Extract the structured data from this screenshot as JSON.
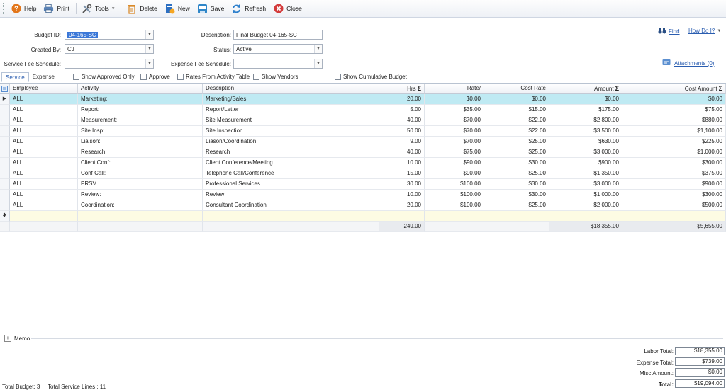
{
  "toolbar": {
    "help": "Help",
    "print": "Print",
    "tools": "Tools",
    "delete": "Delete",
    "new": "New",
    "save": "Save",
    "refresh": "Refresh",
    "close": "Close"
  },
  "form": {
    "budget_id_label": "Budget ID:",
    "budget_id_value": "04-165-SC",
    "created_by_label": "Created By:",
    "created_by_value": "CJ",
    "service_fee_label": "Service Fee Schedule:",
    "service_fee_value": "",
    "description_label": "Description:",
    "description_value": "Final Budget 04-165-SC",
    "status_label": "Status:",
    "status_value": "Active",
    "expense_fee_label": "Expense Fee Schedule:",
    "expense_fee_value": ""
  },
  "links": {
    "find": "Find",
    "how_do_i": "How Do I?",
    "attachments": "Attachments (0)"
  },
  "tabs": [
    "Service",
    "Expense"
  ],
  "options": {
    "show_approved_only": "Show Approved Only",
    "approve": "Approve",
    "rates_from_activity": "Rates From Activity Table",
    "show_vendors": "Show Vendors",
    "show_cumulative": "Show Cumulative Budget"
  },
  "grid": {
    "columns": [
      "Employee",
      "Activity",
      "Description",
      "Hrs",
      "Rate/",
      "Cost Rate",
      "Amount",
      "Cost Amount"
    ],
    "rows": [
      [
        "ALL",
        "Marketing:",
        "Marketing/Sales",
        "20.00",
        "$0.00",
        "$0.00",
        "$0.00",
        "$0.00"
      ],
      [
        "ALL",
        "Report:",
        "Report/Letter",
        "5.00",
        "$35.00",
        "$15.00",
        "$175.00",
        "$75.00"
      ],
      [
        "ALL",
        "Measurement:",
        "Site Measurement",
        "40.00",
        "$70.00",
        "$22.00",
        "$2,800.00",
        "$880.00"
      ],
      [
        "ALL",
        "Site Insp:",
        "Site Inspection",
        "50.00",
        "$70.00",
        "$22.00",
        "$3,500.00",
        "$1,100.00"
      ],
      [
        "ALL",
        "Liaison:",
        "Liason/Coordination",
        "9.00",
        "$70.00",
        "$25.00",
        "$630.00",
        "$225.00"
      ],
      [
        "ALL",
        "Research:",
        "Research",
        "40.00",
        "$75.00",
        "$25.00",
        "$3,000.00",
        "$1,000.00"
      ],
      [
        "ALL",
        "Client Conf:",
        "Client Conference/Meeting",
        "10.00",
        "$90.00",
        "$30.00",
        "$900.00",
        "$300.00"
      ],
      [
        "ALL",
        "Conf Call:",
        "Telephone Call/Conference",
        "15.00",
        "$90.00",
        "$25.00",
        "$1,350.00",
        "$375.00"
      ],
      [
        "ALL",
        "PRSV",
        "Professional Services",
        "30.00",
        "$100.00",
        "$30.00",
        "$3,000.00",
        "$900.00"
      ],
      [
        "ALL",
        "Review:",
        "Review",
        "10.00",
        "$100.00",
        "$30.00",
        "$1,000.00",
        "$300.00"
      ],
      [
        "ALL",
        "Coordination:",
        "Consultant Coordination",
        "20.00",
        "$100.00",
        "$25.00",
        "$2,000.00",
        "$500.00"
      ]
    ],
    "totals": {
      "hrs": "249.00",
      "amount": "$18,355.00",
      "cost_amount": "$5,655.00"
    }
  },
  "memo": {
    "label": "Memo"
  },
  "summary": {
    "labor_label": "Labor Total:",
    "labor_value": "$18,355.00",
    "expense_label": "Expense Total:",
    "expense_value": "$739.00",
    "misc_label": "Misc Amount:",
    "misc_value": "$0.00",
    "total_label": "Total:",
    "total_value": "$19,094.00"
  },
  "status": {
    "total_budget": "Total Budget: 3",
    "total_service_lines": "Total Service Lines : 11"
  }
}
